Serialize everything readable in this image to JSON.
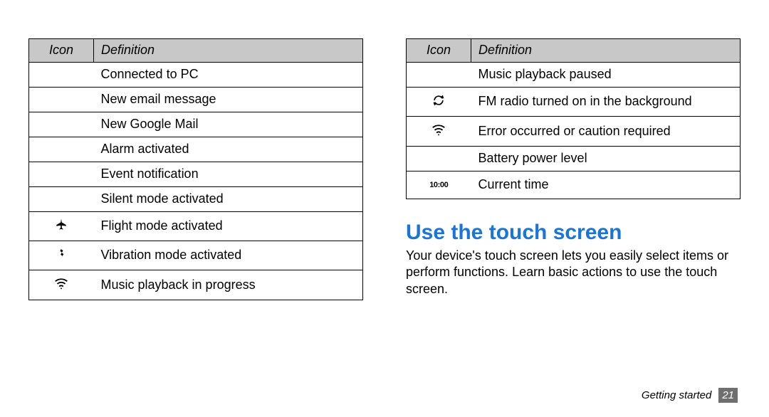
{
  "headers": {
    "icon": "Icon",
    "definition": "Definition"
  },
  "left_table": [
    {
      "icon": "",
      "definition": "Connected to PC"
    },
    {
      "icon": "",
      "definition": "New email message"
    },
    {
      "icon": "",
      "definition": "New Google Mail"
    },
    {
      "icon": "",
      "definition": "Alarm activated"
    },
    {
      "icon": "",
      "definition": "Event notification"
    },
    {
      "icon": "",
      "definition": "Silent mode activated"
    },
    {
      "icon": "flight",
      "definition": "Flight mode activated"
    },
    {
      "icon": "vibration",
      "definition": "Vibration mode activated"
    },
    {
      "icon": "wifi",
      "definition": "Music playback in progress"
    }
  ],
  "right_table": [
    {
      "icon": "",
      "definition": "Music playback paused"
    },
    {
      "icon": "sync",
      "definition": "FM radio turned on in the background"
    },
    {
      "icon": "wifi",
      "definition": "Error occurred or caution required"
    },
    {
      "icon": "",
      "definition": "Battery power level"
    },
    {
      "icon": "time",
      "icon_text": "10:00",
      "definition": "Current time"
    }
  ],
  "section_heading": "Use the touch screen",
  "section_body": "Your device's touch screen lets you easily select items or perform functions. Learn basic actions to use the touch screen.",
  "footer": {
    "chapter": "Getting started",
    "page": "21"
  }
}
